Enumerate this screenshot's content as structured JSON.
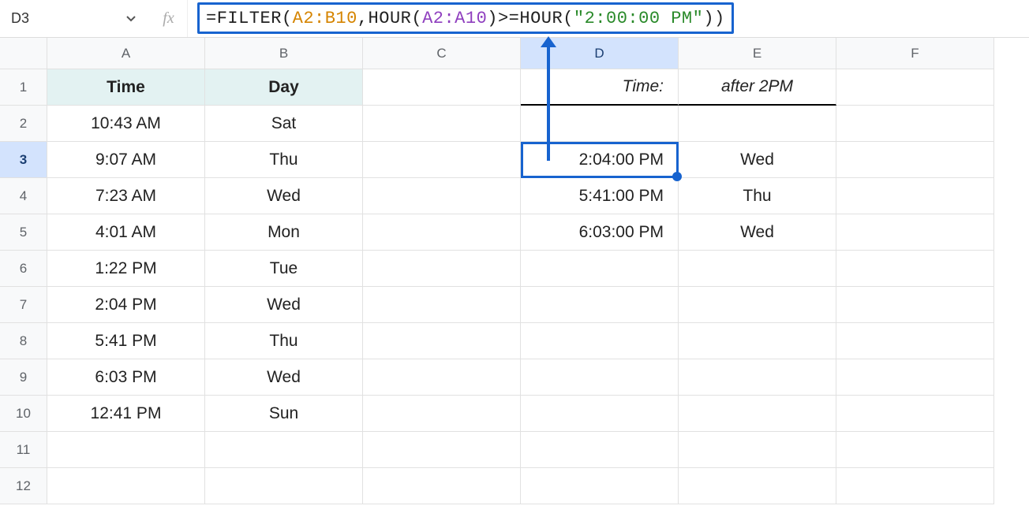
{
  "name_box": "D3",
  "fx_label": "fx",
  "formula": {
    "prefix": "=",
    "fn1": "FILTER",
    "open1": "(",
    "rng1": "A2:B10",
    "comma1": ",",
    "fn2": "HOUR",
    "open2": "(",
    "rng2": "A2:A10",
    "close2": ")",
    "op": ">=",
    "fn3": "HOUR",
    "open3": "(",
    "str": "\"2:00:00 PM\"",
    "close3": ")",
    "close1": ")"
  },
  "col_headers": [
    "A",
    "B",
    "C",
    "D",
    "E",
    "F"
  ],
  "row_headers": [
    "1",
    "2",
    "3",
    "4",
    "5",
    "6",
    "7",
    "8",
    "9",
    "10",
    "11",
    "12"
  ],
  "active_col": "D",
  "active_row": "3",
  "headers": {
    "A1": "Time",
    "B1": "Day",
    "D1": "Time:",
    "E1": "after 2PM"
  },
  "data": {
    "A": [
      "10:43 AM",
      "9:07 AM",
      "7:23 AM",
      "4:01 AM",
      "1:22 PM",
      "2:04 PM",
      "5:41 PM",
      "6:03 PM",
      "12:41 PM"
    ],
    "B": [
      "Sat",
      "Thu",
      "Wed",
      "Mon",
      "Tue",
      "Wed",
      "Thu",
      "Wed",
      "Sun"
    ],
    "D": [
      "",
      "2:04:00 PM",
      "5:41:00 PM",
      "6:03:00 PM",
      "",
      "",
      "",
      "",
      ""
    ],
    "E": [
      "",
      "Wed",
      "Thu",
      "Wed",
      "",
      "",
      "",
      "",
      ""
    ]
  }
}
